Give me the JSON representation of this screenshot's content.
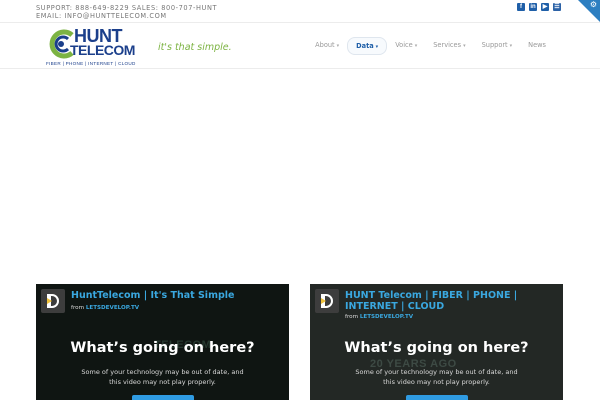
{
  "topbar": {
    "contact": "SUPPORT: 888-649-8229 SALES: 800-707-HUNT EMAIL: INFO@HUNTTELECOM.COM",
    "social": [
      {
        "icon": "facebook-icon",
        "glyph": "f"
      },
      {
        "icon": "linkedin-icon",
        "glyph": "in"
      },
      {
        "icon": "youtube-icon",
        "glyph": "▶"
      },
      {
        "icon": "rss-icon",
        "glyph": "☰"
      }
    ]
  },
  "logo": {
    "word1": "HUNT",
    "word2": "TELECOM",
    "sub": "FIBER  |  PHONE  |  INTERNET  |  CLOUD"
  },
  "tagline": "it's that simple.",
  "nav": [
    {
      "label": "About",
      "chevron": "▾",
      "active": false
    },
    {
      "label": "Data",
      "chevron": "▾",
      "active": true
    },
    {
      "label": "Voice",
      "chevron": "▾",
      "active": false
    },
    {
      "label": "Services",
      "chevron": "▾",
      "active": false
    },
    {
      "label": "Support",
      "chevron": "▾",
      "active": false
    },
    {
      "label": "News",
      "chevron": "",
      "active": false
    }
  ],
  "videos": [
    {
      "title": "HuntTelecom | It's That Simple",
      "from_prefix": "from",
      "from_source": "LETSDEVELOP.TV",
      "background_text": "TELECOM",
      "headline": "What’s going on here?",
      "message": "Some of your technology may be out of date, and this video may not play properly."
    },
    {
      "title": "HUNT Telecom | FIBER | PHONE | INTERNET | CLOUD",
      "from_prefix": "from",
      "from_source": "LETSDEVELOP.TV",
      "background_text": "20 YEARS AGO",
      "headline": "What’s going on here?",
      "message": "Some of your technology may be out of date, and this video may not play properly."
    }
  ],
  "colors": {
    "brand_blue": "#1b3f8b",
    "accent_blue": "#1f5fa8",
    "tagline_green": "#7cb342",
    "video_title": "#3aa8e0"
  }
}
